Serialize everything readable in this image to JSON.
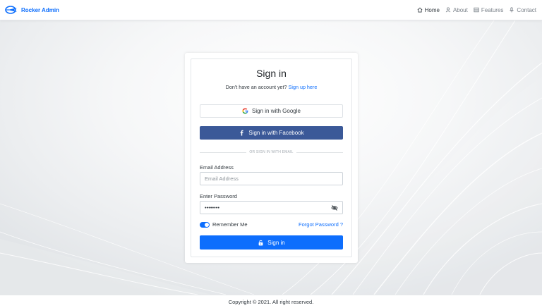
{
  "navbar": {
    "brand": "Rocker Admin",
    "brand_logo_icon": "rocket-logo-icon",
    "items": [
      {
        "label": "Home",
        "icon": "home-icon",
        "active": true
      },
      {
        "label": "About",
        "icon": "user-icon",
        "active": false
      },
      {
        "label": "Features",
        "icon": "grid-icon",
        "active": false
      },
      {
        "label": "Contact",
        "icon": "mic-icon",
        "active": false
      }
    ]
  },
  "signin": {
    "title": "Sign in",
    "no_account_text": "Don't have an account yet?",
    "signup_link": "Sign up here",
    "google_button": "Sign in with Google",
    "facebook_button": "Sign in with Facebook",
    "divider_text": "OR SIGN IN WITH EMAIL",
    "email_label": "Email Address",
    "email_placeholder": "Email Address",
    "email_value": "",
    "password_label": "Enter Password",
    "password_value": "••••••••",
    "remember_label": "Remember Me",
    "remember_checked": true,
    "forgot_link": "Forgot Password ?",
    "submit_button": "Sign in"
  },
  "footer": {
    "copyright": "Copyright © 2021. All right reserved."
  },
  "colors": {
    "primary": "#0d6efd",
    "facebook": "#3b5998",
    "text": "#32393f"
  }
}
